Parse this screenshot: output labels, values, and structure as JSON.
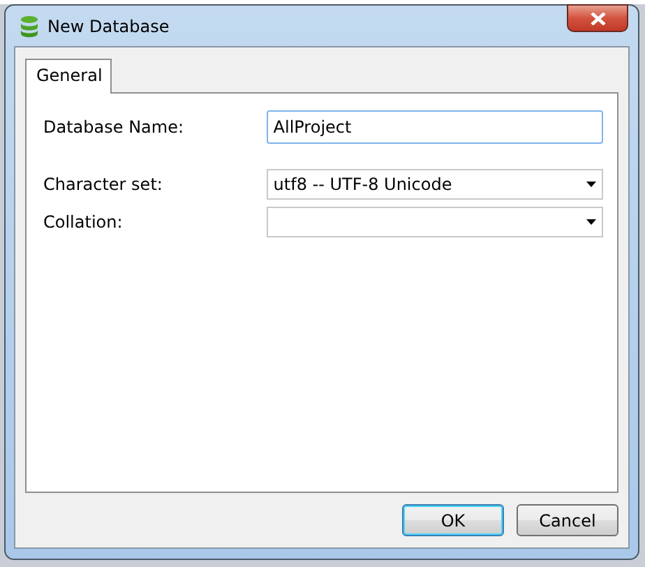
{
  "window": {
    "title": "New Database"
  },
  "tabs": [
    {
      "label": "General",
      "selected": true
    }
  ],
  "fields": [
    {
      "kind": "text",
      "label": "Database Name:",
      "value": "AllProject"
    },
    {
      "kind": "select",
      "label": "Character set:",
      "value": "utf8 -- UTF-8 Unicode"
    },
    {
      "kind": "select",
      "label": "Collation:"
    }
  ],
  "buttons": [
    {
      "label": "OK",
      "default": true
    },
    {
      "label": "Cancel",
      "default": false
    }
  ]
}
